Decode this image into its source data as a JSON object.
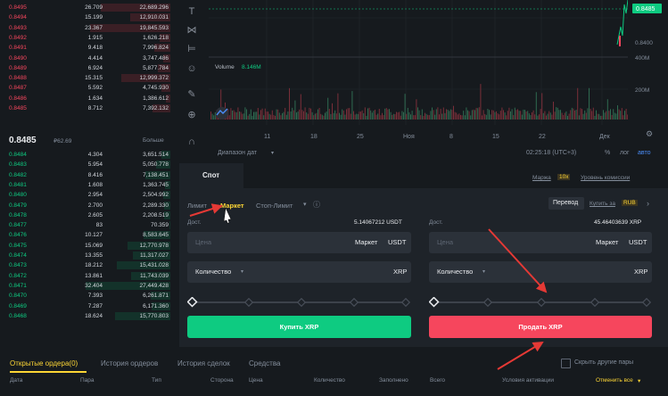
{
  "orderbook": {
    "asks": [
      {
        "price": "0.8495",
        "amount": "26.709",
        "total": "22,689.296",
        "depth": 0.78
      },
      {
        "price": "0.8494",
        "amount": "15.199",
        "total": "12,910.031",
        "depth": 0.45
      },
      {
        "price": "0.8493",
        "amount": "23.367",
        "total": "19,845.593",
        "depth": 0.9
      },
      {
        "price": "0.8492",
        "amount": "1.915",
        "total": "1,626.218",
        "depth": 0.12
      },
      {
        "price": "0.8491",
        "amount": "9.418",
        "total": "7,996.824",
        "depth": 0.18
      },
      {
        "price": "0.8490",
        "amount": "4.414",
        "total": "3,747.486",
        "depth": 0.08
      },
      {
        "price": "0.8489",
        "amount": "6.924",
        "total": "5,877.784",
        "depth": 0.14
      },
      {
        "price": "0.8488",
        "amount": "15.315",
        "total": "12,999.372",
        "depth": 0.55
      },
      {
        "price": "0.8487",
        "amount": "5.592",
        "total": "4,745.930",
        "depth": 0.1
      },
      {
        "price": "0.8486",
        "amount": "1.634",
        "total": "1,386.612",
        "depth": 0.05
      },
      {
        "price": "0.8485",
        "amount": "8.712",
        "total": "7,392.132",
        "depth": 0.2
      }
    ],
    "last_price": "0.8485",
    "last_price_fiat": "₽62.69",
    "more_label": "Больше",
    "bids": [
      {
        "price": "0.8484",
        "amount": "4.304",
        "total": "3,651.514",
        "depth": 0.1
      },
      {
        "price": "0.8483",
        "amount": "5.954",
        "total": "5,050.778",
        "depth": 0.16
      },
      {
        "price": "0.8482",
        "amount": "8.416",
        "total": "7,138.451",
        "depth": 0.28
      },
      {
        "price": "0.8481",
        "amount": "1.608",
        "total": "1,363.745",
        "depth": 0.06
      },
      {
        "price": "0.8480",
        "amount": "2.954",
        "total": "2,504.992",
        "depth": 0.08
      },
      {
        "price": "0.8479",
        "amount": "2.700",
        "total": "2,289.330",
        "depth": 0.07
      },
      {
        "price": "0.8478",
        "amount": "2.605",
        "total": "2,208.519",
        "depth": 0.07
      },
      {
        "price": "0.8477",
        "amount": "83",
        "total": "70.359",
        "depth": 0.01
      },
      {
        "price": "0.8476",
        "amount": "10.127",
        "total": "8,583.645",
        "depth": 0.3
      },
      {
        "price": "0.8475",
        "amount": "15.069",
        "total": "12,770.978",
        "depth": 0.48
      },
      {
        "price": "0.8474",
        "amount": "13.355",
        "total": "11,317.027",
        "depth": 0.42
      },
      {
        "price": "0.8473",
        "amount": "18.212",
        "total": "15,431.028",
        "depth": 0.6
      },
      {
        "price": "0.8472",
        "amount": "13.861",
        "total": "11,743.039",
        "depth": 0.44
      },
      {
        "price": "0.8471",
        "amount": "32.404",
        "total": "27,449.428",
        "depth": 0.95
      },
      {
        "price": "0.8470",
        "amount": "7.393",
        "total": "6,261.871",
        "depth": 0.22
      },
      {
        "price": "0.8469",
        "amount": "7.287",
        "total": "6,171.360",
        "depth": 0.21
      },
      {
        "price": "0.8468",
        "amount": "18.624",
        "total": "15,770.803",
        "depth": 0.62
      }
    ]
  },
  "chart": {
    "current_price": "0.8485",
    "price_scale_bottom": "0.8400",
    "volume_label": "Volume",
    "volume_value": "8.146M",
    "vol_scale_top": "400M",
    "vol_scale_mid": "200M",
    "x_ticks": [
      "11",
      "18",
      "25",
      "Ноя",
      "8",
      "15",
      "22",
      "Дек"
    ],
    "date_range_label": "Диапазон дат",
    "time": "02:25:18 (UTC+3)",
    "pct_label": "%",
    "log_label": "лог",
    "auto_label": "авто",
    "accent": "#fcd535"
  },
  "spot": {
    "tab": "Спот",
    "margin_label": "Маржа",
    "margin_badge": "10x",
    "fee_level": "Уровень комиссии",
    "order_types": {
      "limit": "Лимит",
      "market": "Маркет",
      "stop_limit": "Стоп-Лимит"
    },
    "transfer": "Перевод",
    "buy_for": "Купить за",
    "buy_for_currency": "RUB",
    "buy": {
      "available_label": "Дост.",
      "available_value": "5.14067212 USDT",
      "price_placeholder": "Цена",
      "price_value": "Маркет",
      "price_unit": "USDT",
      "qty_label": "Количество",
      "qty_unit": "XRP",
      "button": "Купить XRP"
    },
    "sell": {
      "available_label": "Дост.",
      "available_value": "45.46403639 XRP",
      "price_placeholder": "Цена",
      "price_value": "Маркет",
      "price_unit": "USDT",
      "qty_label": "Количество",
      "qty_unit": "XRP",
      "button": "Продать XRP"
    },
    "buy_color": "#0ecb81",
    "sell_color": "#f6465d"
  },
  "bottom": {
    "tabs": [
      "Открытые ордера(0)",
      "История ордеров",
      "История сделок",
      "Средства"
    ],
    "hide_pairs": "Скрыть другие пары",
    "columns": [
      "Дата",
      "Пара",
      "Тип",
      "Сторона",
      "Цена",
      "Количество",
      "Заполнено",
      "Всего",
      "Условия активации"
    ],
    "cancel_all": "Отменить все"
  }
}
